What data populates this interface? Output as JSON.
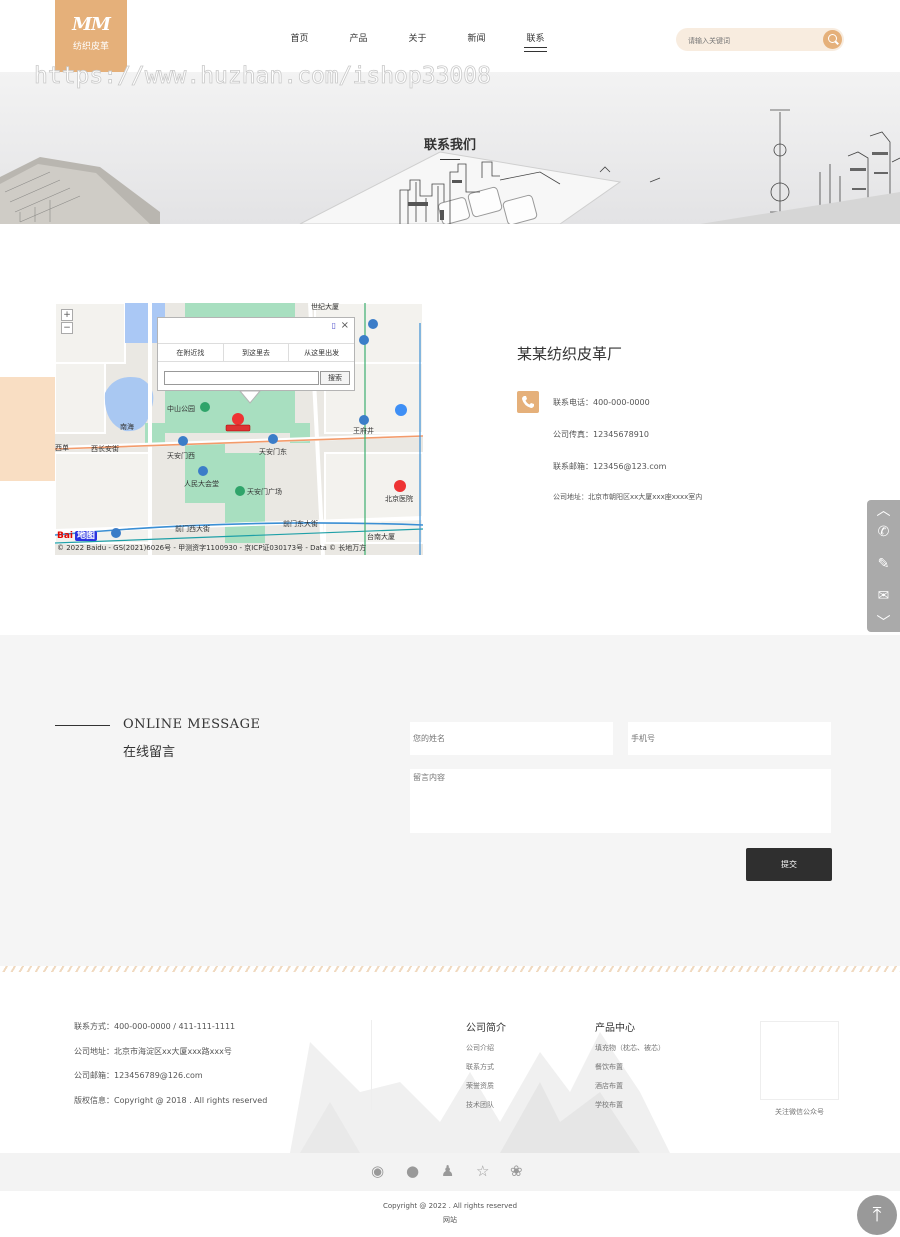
{
  "header": {
    "logo_mark": "MM",
    "logo_text": "纺织皮革",
    "nav": [
      "首页",
      "产品",
      "关于",
      "新闻",
      "联系"
    ],
    "active_nav": "联系",
    "search_placeholder": "请输入关键词"
  },
  "watermark": "https://www.huzhan.com/ishop33008",
  "banner": {
    "title": "联系我们"
  },
  "map": {
    "popup_tabs": [
      "在附近找",
      "到这里去",
      "从这里出发"
    ],
    "search_button": "搜索",
    "zoom_in": "+",
    "zoom_out": "−",
    "close": "×",
    "baidu_logo": "Bai",
    "baidu_logo_map": "地图",
    "copyright": "© 2022 Baidu - GS(2021)6026号 - 甲测资字1100930 - 京ICP证030173号 - Data © 长地万方",
    "labels": {
      "world_building": "世纪大厦",
      "zhongshan_park": "中山公园",
      "west_changan": "西长安街",
      "tiananmen_west": "天安门西",
      "tiananmen_east": "天安门东",
      "peoples_hall": "人民大会堂",
      "tiananmen_square": "天安门广场",
      "wangfujing": "王府井",
      "beijing_hospital": "北京医院",
      "qianmen_west": "前门西大街",
      "qianmen_east": "前门东大街",
      "nanhai": "南海",
      "xidan": "西单",
      "taiping": "台南大厦"
    }
  },
  "contact": {
    "company": "某某纺织皮革厂",
    "phone_label": "联系电话：",
    "phone": "400-000-0000",
    "fax_label": "公司传真：",
    "fax": "12345678910",
    "email_label": "联系邮箱：",
    "email": "123456@123.com",
    "address_label": "公司地址：",
    "address": "北京市朝阳区xx大厦xxx座xxxx室内"
  },
  "message": {
    "title_en": "ONLINE MESSAGE",
    "title_cn": "在线留言",
    "name_placeholder": "您的姓名",
    "phone_placeholder": "手机号",
    "content_placeholder": "留言内容",
    "submit": "提交"
  },
  "footer": {
    "contact_rows": [
      "联系方式：400-000-0000 / 411-111-1111",
      "公司地址：北京市海淀区xx大厦xxx路xxx号",
      "公司邮箱：123456789@126.com",
      "版权信息：Copyright @ 2018 . All rights reserved"
    ],
    "col1_title": "公司简介",
    "col1_items": [
      "公司介绍",
      "联系方式",
      "荣誉资质",
      "技术团队"
    ],
    "col2_title": "产品中心",
    "col2_items": [
      "填充物（枕芯、被芯）",
      "餐饮布置",
      "酒店布置",
      "学校布置"
    ],
    "qr_caption": "关注微信公众号"
  },
  "bottom": {
    "copyright": "Copyright @ 2022 . All rights reserved",
    "site": "网站"
  }
}
